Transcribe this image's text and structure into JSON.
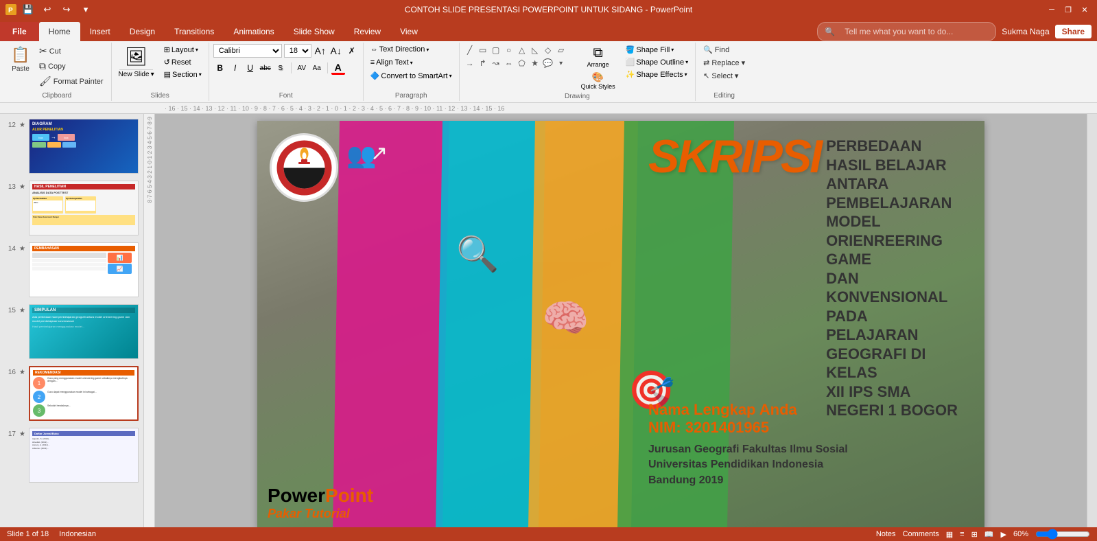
{
  "titlebar": {
    "title": "CONTOH SLIDE PRESENTASI POWERPOINT UNTUK SIDANG - PowerPoint",
    "quickaccess": [
      "save",
      "undo",
      "redo",
      "customize"
    ],
    "wincontrols": [
      "minimize",
      "restore",
      "close"
    ]
  },
  "ribbon": {
    "tabs": [
      "File",
      "Home",
      "Insert",
      "Design",
      "Transitions",
      "Animations",
      "Slide Show",
      "Review",
      "View"
    ],
    "active_tab": "Home",
    "tell_me_placeholder": "Tell me what you want to do...",
    "user": "Sukma Naga",
    "share_label": "Share",
    "groups": {
      "clipboard": {
        "label": "Clipboard",
        "paste_label": "Paste",
        "cut_label": "Cut",
        "copy_label": "Copy",
        "format_painter_label": "Format Painter"
      },
      "slides": {
        "label": "Slides",
        "new_slide_label": "New Slide",
        "layout_label": "Layout",
        "reset_label": "Reset",
        "section_label": "Section"
      },
      "font": {
        "label": "Font",
        "font_name": "Calibri",
        "font_size": "18",
        "bold": "B",
        "italic": "I",
        "underline": "U",
        "strikethrough": "abc",
        "font_color_label": "A"
      },
      "paragraph": {
        "label": "Paragraph",
        "text_direction_label": "Text Direction",
        "align_text_label": "Align Text",
        "convert_smartart_label": "Convert to SmartArt"
      },
      "drawing": {
        "label": "Drawing",
        "arrange_label": "Arrange",
        "quick_styles_label": "Quick Styles",
        "shape_fill_label": "Shape Fill",
        "shape_outline_label": "Shape Outline",
        "shape_effects_label": "Shape Effects"
      },
      "editing": {
        "label": "Editing",
        "find_label": "Find",
        "replace_label": "Replace",
        "select_label": "Select"
      }
    }
  },
  "slides": {
    "items": [
      {
        "num": "12",
        "star": "★",
        "label": "Diagram Alur Penelitian"
      },
      {
        "num": "13",
        "star": "★",
        "label": "Hasil Penelitian Analisis Data Posttest"
      },
      {
        "num": "14",
        "star": "★",
        "label": "Pembahasan"
      },
      {
        "num": "15",
        "star": "★",
        "label": "Simpulan"
      },
      {
        "num": "16",
        "star": "★",
        "label": "Rekomendasi"
      },
      {
        "num": "17",
        "star": "★",
        "label": "Daftar Jurnal/Buku"
      }
    ]
  },
  "main_slide": {
    "skripsi_label": "SKRIPSI",
    "title_line1": "PERBEDAAN HASIL BELAJAR",
    "title_line2": "ANTARA PEMBELAJARAN",
    "title_line3": "MODEL ORIENREERING GAME",
    "title_line4": "DAN KONVENSIONAL PADA",
    "title_line5": "PELAJARAN GEOGRAFI DI KELAS",
    "title_line6": "XII IPS SMA  NEGERI 1 BOGOR",
    "name_label": "Nama Lengkap Anda",
    "nim_label": "NIM: 3201401965",
    "institution_line1": "Jurusan Geografi  Fakultas Ilmu Sosial",
    "institution_line2": "Universitas Pendidikan Indonesia",
    "institution_line3": "Bandung 2019",
    "brand_power": "Power",
    "brand_point": "Point",
    "brand_sub": "Pakar Tutorial"
  },
  "statusbar": {
    "slide_info": "Slide 1 of 18",
    "language": "Indonesian",
    "notes": "Notes",
    "comments": "Comments",
    "zoom": "60%",
    "view_normal": "Normal",
    "view_outline": "Outline View",
    "view_slide_sorter": "Slide Sorter",
    "view_reading": "Reading View",
    "view_slideshow": "Slide Show"
  }
}
